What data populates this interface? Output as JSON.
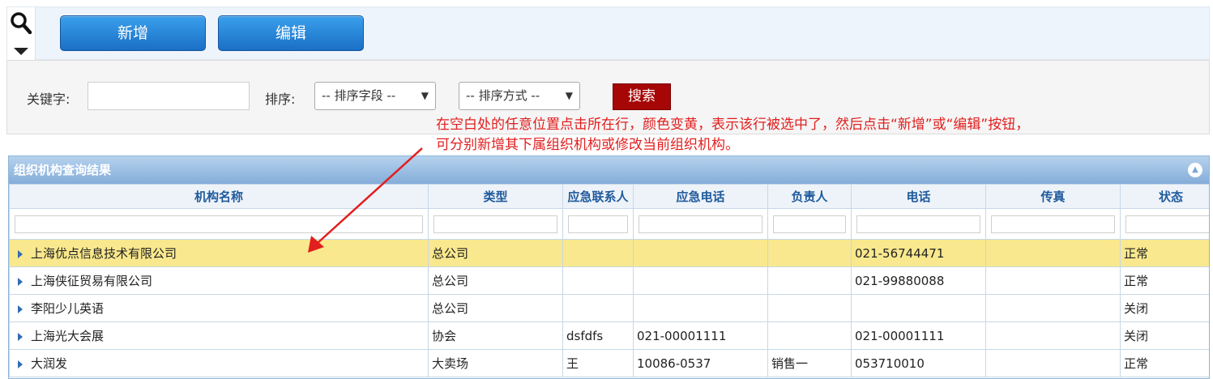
{
  "toolbar": {
    "add_label": "新增",
    "edit_label": "编辑"
  },
  "search": {
    "keyword_label": "关键字:",
    "keyword_value": "",
    "sort_label": "排序:",
    "sort_field": "-- 排序字段 --",
    "sort_order": "-- 排序方式 --",
    "button_label": "搜索"
  },
  "annotation": {
    "line1": "在空白处的任意位置点击所在行，颜色变黄，表示该行被选中了，然后点击“新增”或“编辑”按钮，",
    "line2": "可分别新增其下属组织机构或修改当前组织机构。",
    "color": "#e21e1e"
  },
  "panel": {
    "title": "组织机构查询结果"
  },
  "columns": [
    "机构名称",
    "类型",
    "应急联系人",
    "应急电话",
    "负责人",
    "电话",
    "传真",
    "状态"
  ],
  "rows": [
    {
      "name": "上海优点信息技术有限公司",
      "type": "总公司",
      "contact": "",
      "em_phone": "",
      "manager": "",
      "phone": "021-56744471",
      "fax": "",
      "status": "正常",
      "selected": true
    },
    {
      "name": "上海侠征贸易有限公司",
      "type": "总公司",
      "contact": "",
      "em_phone": "",
      "manager": "",
      "phone": "021-99880088",
      "fax": "",
      "status": "正常",
      "selected": false
    },
    {
      "name": "李阳少儿英语",
      "type": "总公司",
      "contact": "",
      "em_phone": "",
      "manager": "",
      "phone": "",
      "fax": "",
      "status": "关闭",
      "selected": false
    },
    {
      "name": "上海光大会展",
      "type": "协会",
      "contact": "dsfdfs",
      "em_phone": "021-00001111",
      "manager": "",
      "phone": "021-00001111",
      "fax": "",
      "status": "关闭",
      "selected": false
    },
    {
      "name": "大润发",
      "type": "大卖场",
      "contact": "王",
      "em_phone": "10086-0537",
      "manager": "销售一",
      "phone": "053710010",
      "fax": "",
      "status": "正常",
      "selected": false
    }
  ],
  "colors": {
    "selected_row": "#f9e88d",
    "header_text": "#1f5a9c",
    "search_button": "#a60606",
    "primary_button": "#1a6fc5"
  },
  "icons": [
    "search-icon",
    "caret-down-icon",
    "collapse-icon",
    "expand-row-icon",
    "annotation-arrow"
  ]
}
